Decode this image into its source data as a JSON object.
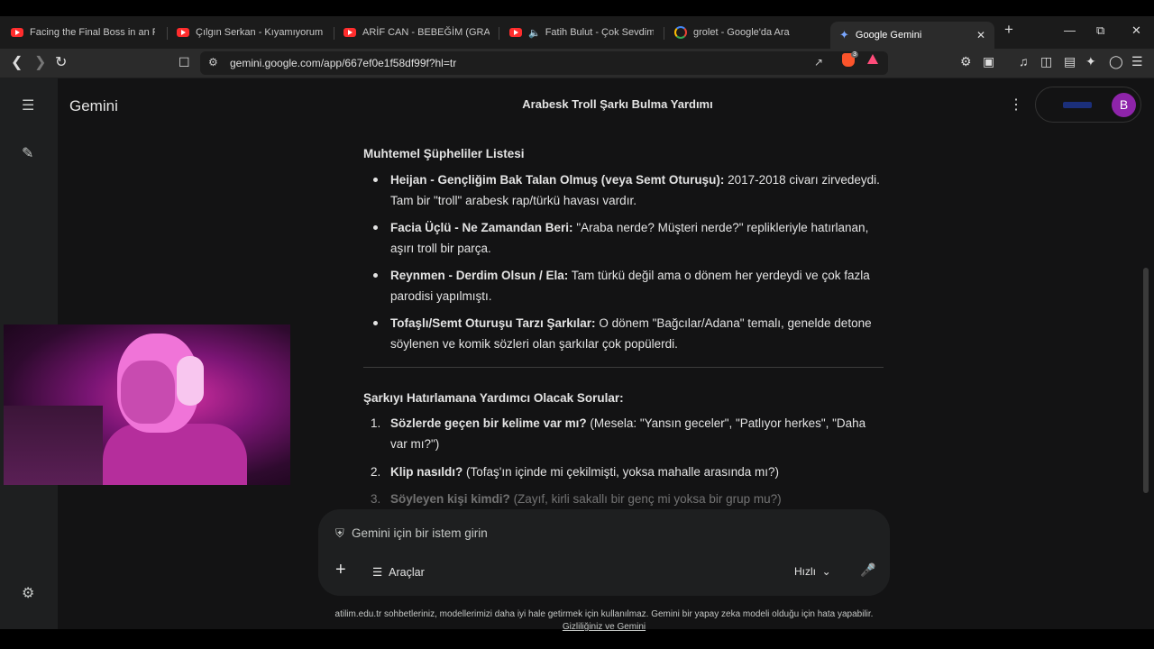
{
  "browser": {
    "tabs": [
      {
        "title": "Facing the Final Boss in an RPG",
        "icon": "youtube-icon"
      },
      {
        "title": "Çılgın Serkan - Kıyamıyorum San",
        "icon": "youtube-icon"
      },
      {
        "title": "ARİF CAN - BEBEĞİM (GRANİ) -",
        "icon": "youtube-icon"
      },
      {
        "title": "Fatih Bulut - Çok Sevdim Yal",
        "icon": "youtube-icon"
      },
      {
        "title": "grolet - Google'da Ara",
        "icon": "google-icon"
      },
      {
        "title": "Google Gemini",
        "icon": "gemini-icon"
      }
    ],
    "url": "gemini.google.com/app/667ef0e1f58df99f?hl=tr",
    "brave_badge": "3"
  },
  "app": {
    "brand": "Gemini",
    "conversation_title": "Arabesk Troll Şarkı Bulma Yardımı",
    "avatar_letter": "B",
    "accent": "#8e24aa"
  },
  "content": {
    "section1_title": "Muhtemel Şüpheliler Listesi",
    "suspects": [
      {
        "bold": "Heijan - Gençliğim Bak Talan Olmuş (veya Semt Oturuşu):",
        "text": " 2017-2018 civarı zirvedeydi. Tam bir \"troll\" arabesk rap/türkü havası vardır."
      },
      {
        "bold": "Facia Üçlü - Ne Zamandan Beri:",
        "text": " \"Araba nerde? Müşteri nerde?\" replikleriyle hatırlanan, aşırı troll bir parça."
      },
      {
        "bold": "Reynmen - Derdim Olsun / Ela:",
        "text": " Tam türkü değil ama o dönem her yerdeydi ve çok fazla parodisi yapılmıştı."
      },
      {
        "bold": "Tofaşlı/Semt Oturuşu Tarzı Şarkılar:",
        "text": " O dönem \"Bağcılar/Adana\" temalı, genelde detone söylenen ve komik sözleri olan şarkılar çok popülerdi."
      }
    ],
    "section2_title": "Şarkıyı Hatırlamana Yardımcı Olacak Sorular:",
    "questions": [
      {
        "num": "1.",
        "bold": "Sözlerde geçen bir kelime var mı?",
        "text": " (Mesela: \"Yansın geceler\", \"Patlıyor herkes\", \"Daha var mı?\")"
      },
      {
        "num": "2.",
        "bold": "Klip nasıldı?",
        "text": " (Tofaş'ın içinde mi çekilmişti, yoksa mahalle arasında mı?)"
      },
      {
        "num": "3.",
        "bold": "Söyleyen kişi kimdi?",
        "text": " (Zayıf, kirli sakallı bir genç mi yoksa bir grup mu?)"
      }
    ]
  },
  "composer": {
    "placeholder": "Gemini için bir istem girin",
    "tools_label": "Araçlar",
    "model_label": "Hızlı"
  },
  "footer": {
    "disclaimer": "atilim.edu.tr sohbetleriniz, modellerimizi daha iyi hale getirmek için kullanılmaz. Gemini bir yapay zeka modeli olduğu için hata yapabilir.",
    "privacy_link": "Gizliliğiniz ve Gemini"
  }
}
